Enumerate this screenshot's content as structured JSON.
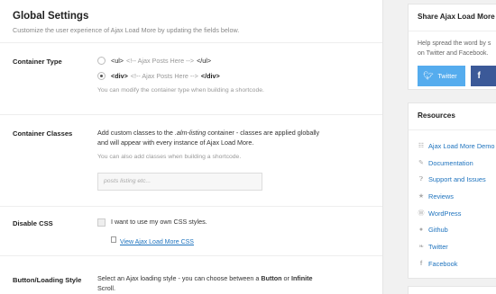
{
  "main": {
    "title": "Global Settings",
    "description": "Customize the user experience of Ajax Load More by updating the fields below.",
    "container_type": {
      "label": "Container Type",
      "option_ul_tag": "<ul>",
      "option_ul_comment": "<!-- Ajax Posts Here -->",
      "option_ul_close": "</ul>",
      "option_div_tag": "<div>",
      "option_div_comment": "<!-- Ajax Posts Here -->",
      "option_div_close": "</div>",
      "selected": "div",
      "hint": "You can modify the container type when building a shortcode."
    },
    "container_classes": {
      "label": "Container Classes",
      "text_before": "Add custom classes to the ",
      "text_em": ".alm-listing",
      "text_after": " container - classes are applied globally",
      "text_line2": "and will appear with every instance of Ajax Load More.",
      "hint": "You can also add classes when building a shortcode.",
      "placeholder": "posts listing etc..."
    },
    "disable_css": {
      "label": "Disable CSS",
      "checkbox_label": "I want to use my own CSS styles.",
      "checked": false,
      "link": "View Ajax Load More CSS"
    },
    "button_style": {
      "label": "Button/Loading Style",
      "text_line1_before": "Select an Ajax loading style - you can choose between a ",
      "text_line1_bold1": "Button",
      "text_line1_mid": " or ",
      "text_line1_bold2": "Infinite",
      "text_line2": "Scroll."
    }
  },
  "sidebar": {
    "share": {
      "title": "Share Ajax Load More",
      "text_line1": "Help spread the word by s",
      "text_line2": "on Twitter and Facebook.",
      "twitter_label": "Twitter",
      "twitter_icon": "twitter-bird",
      "facebook_label": "f"
    },
    "resources": {
      "title": "Resources",
      "items": [
        {
          "label": "Ajax Load More Demo",
          "icon": "rss"
        },
        {
          "label": "Documentation",
          "icon": "pencil"
        },
        {
          "label": "Support and Issues",
          "icon": "question"
        },
        {
          "label": "Reviews",
          "icon": "star"
        },
        {
          "label": "WordPress",
          "icon": "wordpress"
        },
        {
          "label": "Github",
          "icon": "github"
        },
        {
          "label": "Twitter",
          "icon": "twitter"
        },
        {
          "label": "Facebook",
          "icon": "facebook"
        }
      ]
    }
  },
  "colors": {
    "link": "#1e73be",
    "twitter": "#55acee",
    "facebook": "#3b5998"
  }
}
